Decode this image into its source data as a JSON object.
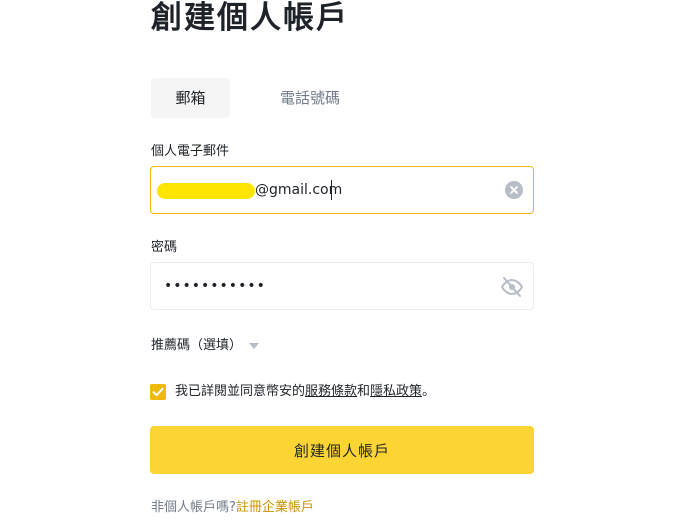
{
  "title": "創建個人帳戶",
  "tabs": [
    {
      "label": "郵箱",
      "active": true
    },
    {
      "label": "電話號碼",
      "active": false
    }
  ],
  "email": {
    "label": "個人電子郵件",
    "value_suffix": "@gmail.com"
  },
  "password": {
    "label": "密碼",
    "value_masked": "•••••••••••"
  },
  "referral": {
    "label": "推薦碼（選填）"
  },
  "agreement": {
    "checked": true,
    "prefix": "我已詳閱並同意幣安的",
    "terms_link": "服務條款",
    "middle": "和",
    "privacy_link": "隱私政策",
    "suffix": "。"
  },
  "submit_label": "創建個人帳戶",
  "footer": {
    "prefix": "非個人帳戶嗎?",
    "link": "註冊企業帳戶"
  },
  "colors": {
    "accent": "#fcd535",
    "accent_border": "#f0b90b",
    "link": "#c99400",
    "muted": "#707a8a"
  }
}
